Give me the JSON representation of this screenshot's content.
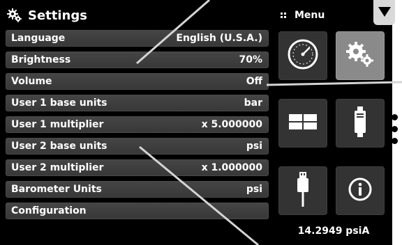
{
  "header": {
    "title": "Settings",
    "icon": "gears-icon"
  },
  "settings": [
    {
      "label": "Language",
      "value": "English (U.S.A.)"
    },
    {
      "label": "Brightness",
      "value": "70%"
    },
    {
      "label": "Volume",
      "value": "Off"
    },
    {
      "label": "User 1 base units",
      "value": "bar"
    },
    {
      "label": "User 1 multiplier",
      "value": "x 5.000000"
    },
    {
      "label": "User 2 base units",
      "value": "psi"
    },
    {
      "label": "User 2 multiplier",
      "value": "x 1.000000"
    },
    {
      "label": "Barometer Units",
      "value": "psi"
    },
    {
      "label": "Configuration",
      "value": ""
    }
  ],
  "menu": {
    "label": "Menu",
    "tiles": [
      "gauge-icon",
      "gears-icon",
      "split-panel-icon",
      "sensor-module-icon",
      "usb-plug-icon",
      "info-icon"
    ],
    "active_tile": "gears-icon"
  },
  "status": {
    "barometer_reading": "14.2949 psiA"
  },
  "colors": {
    "background": "#000000",
    "row": "#404040",
    "tile": "#333333",
    "tile_active": "#8a8a8a"
  }
}
